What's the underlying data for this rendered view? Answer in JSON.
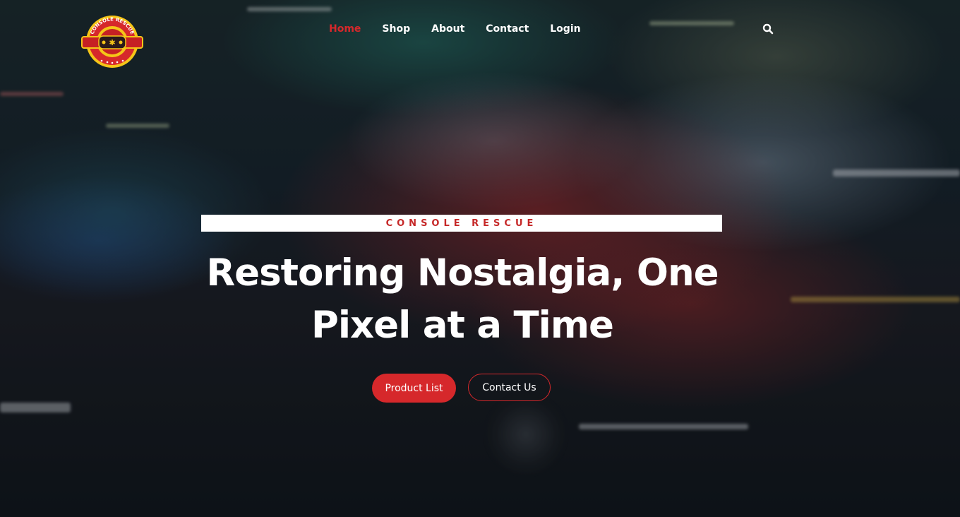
{
  "brand": {
    "logo_text": "CONSOLE RESCUE",
    "accent_color": "#d6282b",
    "logo_yellow": "#f5c518"
  },
  "nav": {
    "items": [
      {
        "label": "Home",
        "active": true
      },
      {
        "label": "Shop",
        "active": false
      },
      {
        "label": "About",
        "active": false
      },
      {
        "label": "Contact",
        "active": false
      },
      {
        "label": "Login",
        "active": false
      }
    ],
    "search_icon": "search-icon"
  },
  "hero": {
    "tagline": "CONSOLE RESCUE",
    "headline_line1": "Restoring Nostalgia, One",
    "headline_line2": "Pixel at a Time",
    "primary_button": "Product List",
    "secondary_button": "Contact Us",
    "background": "blurred ambulance at night"
  }
}
